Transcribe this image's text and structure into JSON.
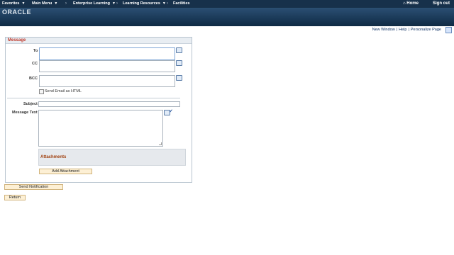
{
  "nav": {
    "favorites": "Favorites",
    "main_menu": "Main Menu",
    "enterprise_learning": "Enterprise Learning",
    "learning_resources": "Learning Resources",
    "facilities": "Facilities",
    "home": "Home",
    "sign_out": "Sign out"
  },
  "logo": {
    "text": "ORACLE"
  },
  "toplinks": {
    "new_window": "New Window",
    "help": "Help",
    "personalize": "Personalize Page"
  },
  "message_panel": {
    "title": "Message",
    "to_label": "To",
    "cc_label": "CC",
    "bcc_label": "BCC",
    "send_html_label": "Send Email as HTML",
    "subject_label": "Subject",
    "message_text_label": "Message Text",
    "to_value": "",
    "cc_value": "",
    "bcc_value": "",
    "subject_value": "",
    "message_value": ""
  },
  "attachments": {
    "title": "Attachments",
    "add_button": "Add Attachment"
  },
  "buttons": {
    "send_notification": "Send Notification",
    "return": "Return"
  },
  "colors": {
    "nav_bg": "#17314b",
    "banner_top": "#2b4f73",
    "section_title": "#c0392b",
    "button_bg": "#fdf0d5"
  }
}
